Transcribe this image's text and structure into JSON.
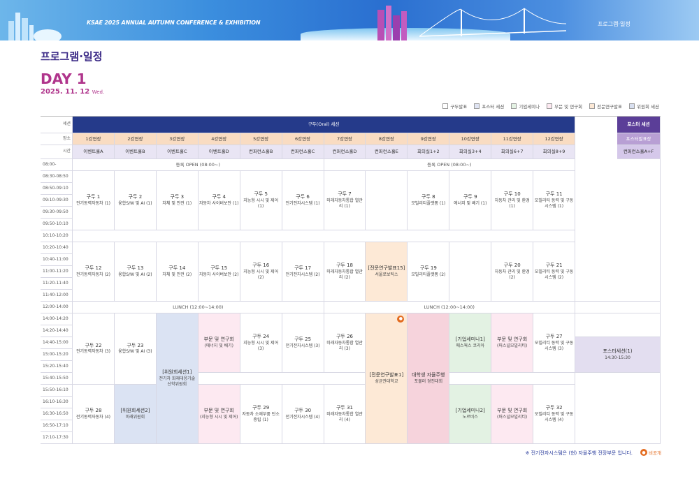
{
  "banner": {
    "title": "KSAE 2025 ANNUAL AUTUMN CONFERENCE & EXHIBITION",
    "nav": "프로그램·일정"
  },
  "page": {
    "heading": "프로그램·일정",
    "day": "DAY 1",
    "date": "2025. 11. 12",
    "weekday": "Wed."
  },
  "legend": [
    {
      "label": "구두발표",
      "color": "#ffffff"
    },
    {
      "label": "포스터 세션",
      "color": "#dfe4f3"
    },
    {
      "label": "기업세미나",
      "color": "#e3f2e3"
    },
    {
      "label": "부문 및 연구회",
      "color": "#fde9f1"
    },
    {
      "label": "전문연구발표",
      "color": "#fde9d6"
    },
    {
      "label": "위원회 세션",
      "color": "#d9e0f0"
    }
  ],
  "labels": {
    "session": "세션",
    "place": "장소",
    "time": "시간"
  },
  "header": {
    "oral": "구두(Oral) 세션",
    "poster": "포스터 세션",
    "poster_room": "포스터발표장"
  },
  "rooms": [
    "1강연장",
    "2강연장",
    "3강연장",
    "4강연장",
    "5강연장",
    "6강연장",
    "7강연장",
    "8강연장",
    "9강연장",
    "10강연장",
    "11강연장",
    "12강연장"
  ],
  "halls": [
    "이벤트홀A",
    "이벤트홀B",
    "이벤트홀C",
    "이벤트홀D",
    "컨퍼런스홀B",
    "컨퍼런스홀C",
    "컨퍼런스홀D",
    "컨퍼런스홀E",
    "회의실1+2",
    "회의실3+4",
    "회의실6+7",
    "회의실8+9"
  ],
  "poster_hall": "컨퍼런스홀A+F",
  "times": [
    "08:00-",
    "08:30-08:50",
    "08:50-09:10",
    "09:10-09:30",
    "09:30-09:50",
    "09:50-10:10",
    "10:10-10:20",
    "10:20-10:40",
    "10:40-11:00",
    "11:00-11:20",
    "11:20-11:40",
    "11:40-12:00",
    "12:00-14:00",
    "14:00-14:20",
    "14:20-14:40",
    "14:40-15:00",
    "15:00-15:20",
    "15:20-15:40",
    "15:40-15:50",
    "15:50-16:10",
    "16:10-16:30",
    "16:30-16:50",
    "16:50-17:10",
    "17:10-17:30"
  ],
  "bands": {
    "registration": "등록 OPEN",
    "registration_time": "(08:00~)",
    "lunch": "LUNCH",
    "lunch_time": "(12:00~14:00)"
  },
  "block1": [
    {
      "t": "구두 1",
      "d": "전기동력자동차 (1)"
    },
    {
      "t": "구두 2",
      "d": "융합S/W 및 AI (1)"
    },
    {
      "t": "구두 3",
      "d": "차체 및 안전 (1)"
    },
    {
      "t": "구두 4",
      "d": "자동차 사이버보안 (1)"
    },
    {
      "t": "구두 5",
      "d": "지능형 시시 및 제어 (1)"
    },
    {
      "t": "구두 6",
      "d": "전기전자시스템 (1)"
    },
    {
      "t": "구두 7",
      "d": "미래자동차통합 열관리 (1)"
    },
    {
      "t": "",
      "d": ""
    },
    {
      "t": "구두 8",
      "d": "모빌리티플랫폼 (1)"
    },
    {
      "t": "구두 9",
      "d": "에너지 및 배기 (1)"
    },
    {
      "t": "구두 10",
      "d": "자동차 관리 및 환경 (1)"
    },
    {
      "t": "구두 11",
      "d": "모빌리티 동력 및 구동 시스템 (1)"
    }
  ],
  "block2": [
    {
      "t": "구두 12",
      "d": "전기동력자동차 (2)"
    },
    {
      "t": "구두 13",
      "d": "융합S/W 및 AI (2)"
    },
    {
      "t": "구두 14",
      "d": "차체 및 안전 (2)"
    },
    {
      "t": "구두 15",
      "d": "자동차 사이버보안 (2)"
    },
    {
      "t": "구두 16",
      "d": "지능형 시시 및 제어 (2)"
    },
    {
      "t": "구두 17",
      "d": "전기전자시스템 (2)"
    },
    {
      "t": "구두 18",
      "d": "미래자동차통합 열관리 (2)"
    },
    {
      "t": "[전문연구발표15]",
      "d": "서울로보틱스"
    },
    {
      "t": "구두 19",
      "d": "모빌리티플랫폼 (2)"
    },
    {
      "t": "",
      "d": ""
    },
    {
      "t": "구두 20",
      "d": "자동차 관리 및 환경 (2)"
    },
    {
      "t": "구두 21",
      "d": "모빌리티 동력 및 구동 시스템 (2)"
    }
  ],
  "block3": {
    "c1a": {
      "t": "구두 22",
      "d": "전기동력자동차 (3)"
    },
    "c2a": {
      "t": "구두 23",
      "d": "융합S/W 및 AI (3)"
    },
    "c3": {
      "t": "[위원회세션1]",
      "d": "전기차 화재대응기술 산학위원회"
    },
    "c4a": {
      "t": "부문 및 연구회",
      "d": "(에너지 및 배기)"
    },
    "c5a": {
      "t": "구두 24",
      "d": "지능형 시시 및 제어 (3)"
    },
    "c6a": {
      "t": "구두 25",
      "d": "전기전자시스템 (3)"
    },
    "c7a": {
      "t": "구두 26",
      "d": "미래자동차통합 열관리 (3)"
    },
    "c8": {
      "t": "[전문연구발표1]",
      "d": "성균관대학교"
    },
    "c9": {
      "t": "대학생 자율주행",
      "d": "포뮬러 경진대회"
    },
    "c10a": {
      "t": "[기업세미나1]",
      "d": "매스웍스 코리아"
    },
    "c11a": {
      "t": "부문 및 연구회",
      "d": "(퍼스널모빌리티)"
    },
    "c12a": {
      "t": "구두 27",
      "d": "모빌리티 동력 및 구동 시스템 (3)"
    },
    "poster": {
      "t": "포스터세션(1)",
      "d": "14:30-15:30"
    },
    "c1b": {
      "t": "구두 28",
      "d": "전기동력자동차 (4)"
    },
    "c2b": {
      "t": "[위원회세션2]",
      "d": "미래위원회"
    },
    "c4b": {
      "t": "부문 및 연구회",
      "d": "(지능형 시시 및 제어)"
    },
    "c5b": {
      "t": "구두 29",
      "d": "자동차 소재부품 탄소중립 (1)"
    },
    "c6b": {
      "t": "구두 30",
      "d": "전기전자시스템 (4)"
    },
    "c7b": {
      "t": "구두 31",
      "d": "미래자동차통합 열관리 (4)"
    },
    "c10b": {
      "t": "[기업세미나2]",
      "d": "노르비스"
    },
    "c11b": {
      "t": "부문 및 연구회",
      "d": "(퍼스널모빌리티)"
    },
    "c12b": {
      "t": "구두 32",
      "d": "모빌리티 동력 및 구동 시스템 (4)"
    }
  },
  "footnote": "※ 전기전자시스템은 (현) 자율주행 전장부문 입니다.",
  "private_label": "비공개"
}
